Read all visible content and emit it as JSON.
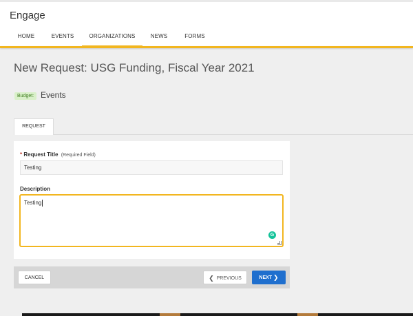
{
  "app": {
    "title": "Engage"
  },
  "nav": {
    "items": [
      {
        "label": "HOME"
      },
      {
        "label": "EVENTS"
      },
      {
        "label": "ORGANIZATIONS"
      },
      {
        "label": "NEWS"
      },
      {
        "label": "FORMS"
      }
    ],
    "active": "ORGANIZATIONS",
    "accent_color": "#f2b61f"
  },
  "page": {
    "title": "New Request: USG Funding, Fiscal Year 2021"
  },
  "budget": {
    "badge_label": "Budget:",
    "value": "Events"
  },
  "tabs": [
    {
      "label": "REQUEST"
    }
  ],
  "form": {
    "request_title": {
      "required_marker": "*",
      "label": "Request Title",
      "hint": "(Required Field)",
      "value": "Testing"
    },
    "description": {
      "label": "Description",
      "value": "Testing",
      "grammarly_icon": "G"
    }
  },
  "actions": {
    "cancel_label": "CANCEL",
    "previous_label": "PREVIOUS",
    "next_label": "NEXT",
    "primary_color": "#1f6fce"
  }
}
